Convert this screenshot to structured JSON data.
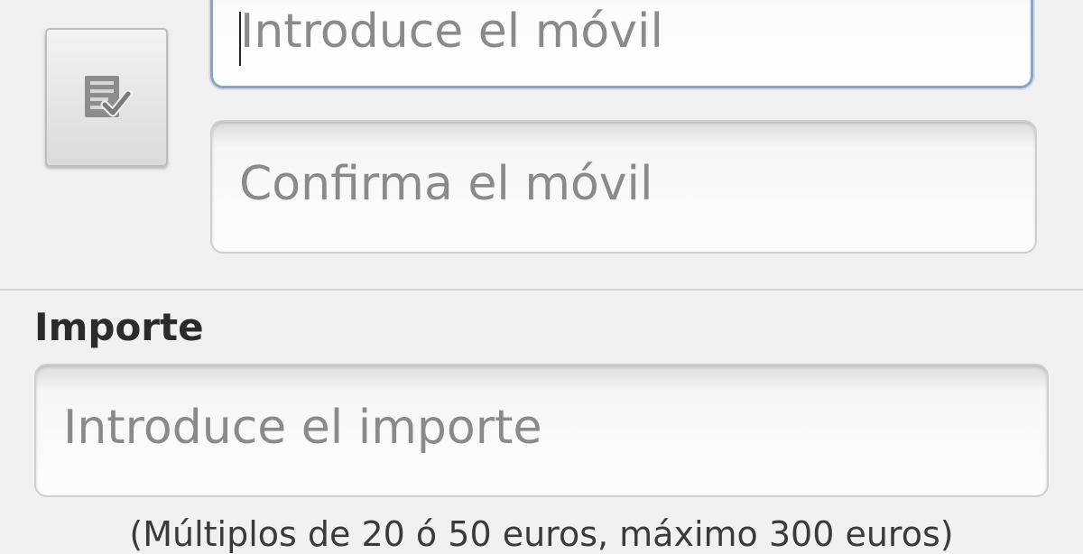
{
  "contacts_button": {
    "icon": "contacts-list-check-icon"
  },
  "phone_field": {
    "placeholder": "Introduce el móvil",
    "value": "",
    "focused": true
  },
  "confirm_phone_field": {
    "placeholder": "Confirma el móvil",
    "value": ""
  },
  "amount_section": {
    "label": "Importe",
    "amount_field": {
      "placeholder": "Introduce el importe",
      "value": ""
    },
    "hint": "(Múltiplos de 20 ó 50 euros, máximo 300 euros)"
  },
  "colors": {
    "background": "#f1f1f1",
    "focus_border": "#8fa4bd",
    "placeholder_text": "#8a8a8a",
    "label_text": "#2b2b2b"
  }
}
